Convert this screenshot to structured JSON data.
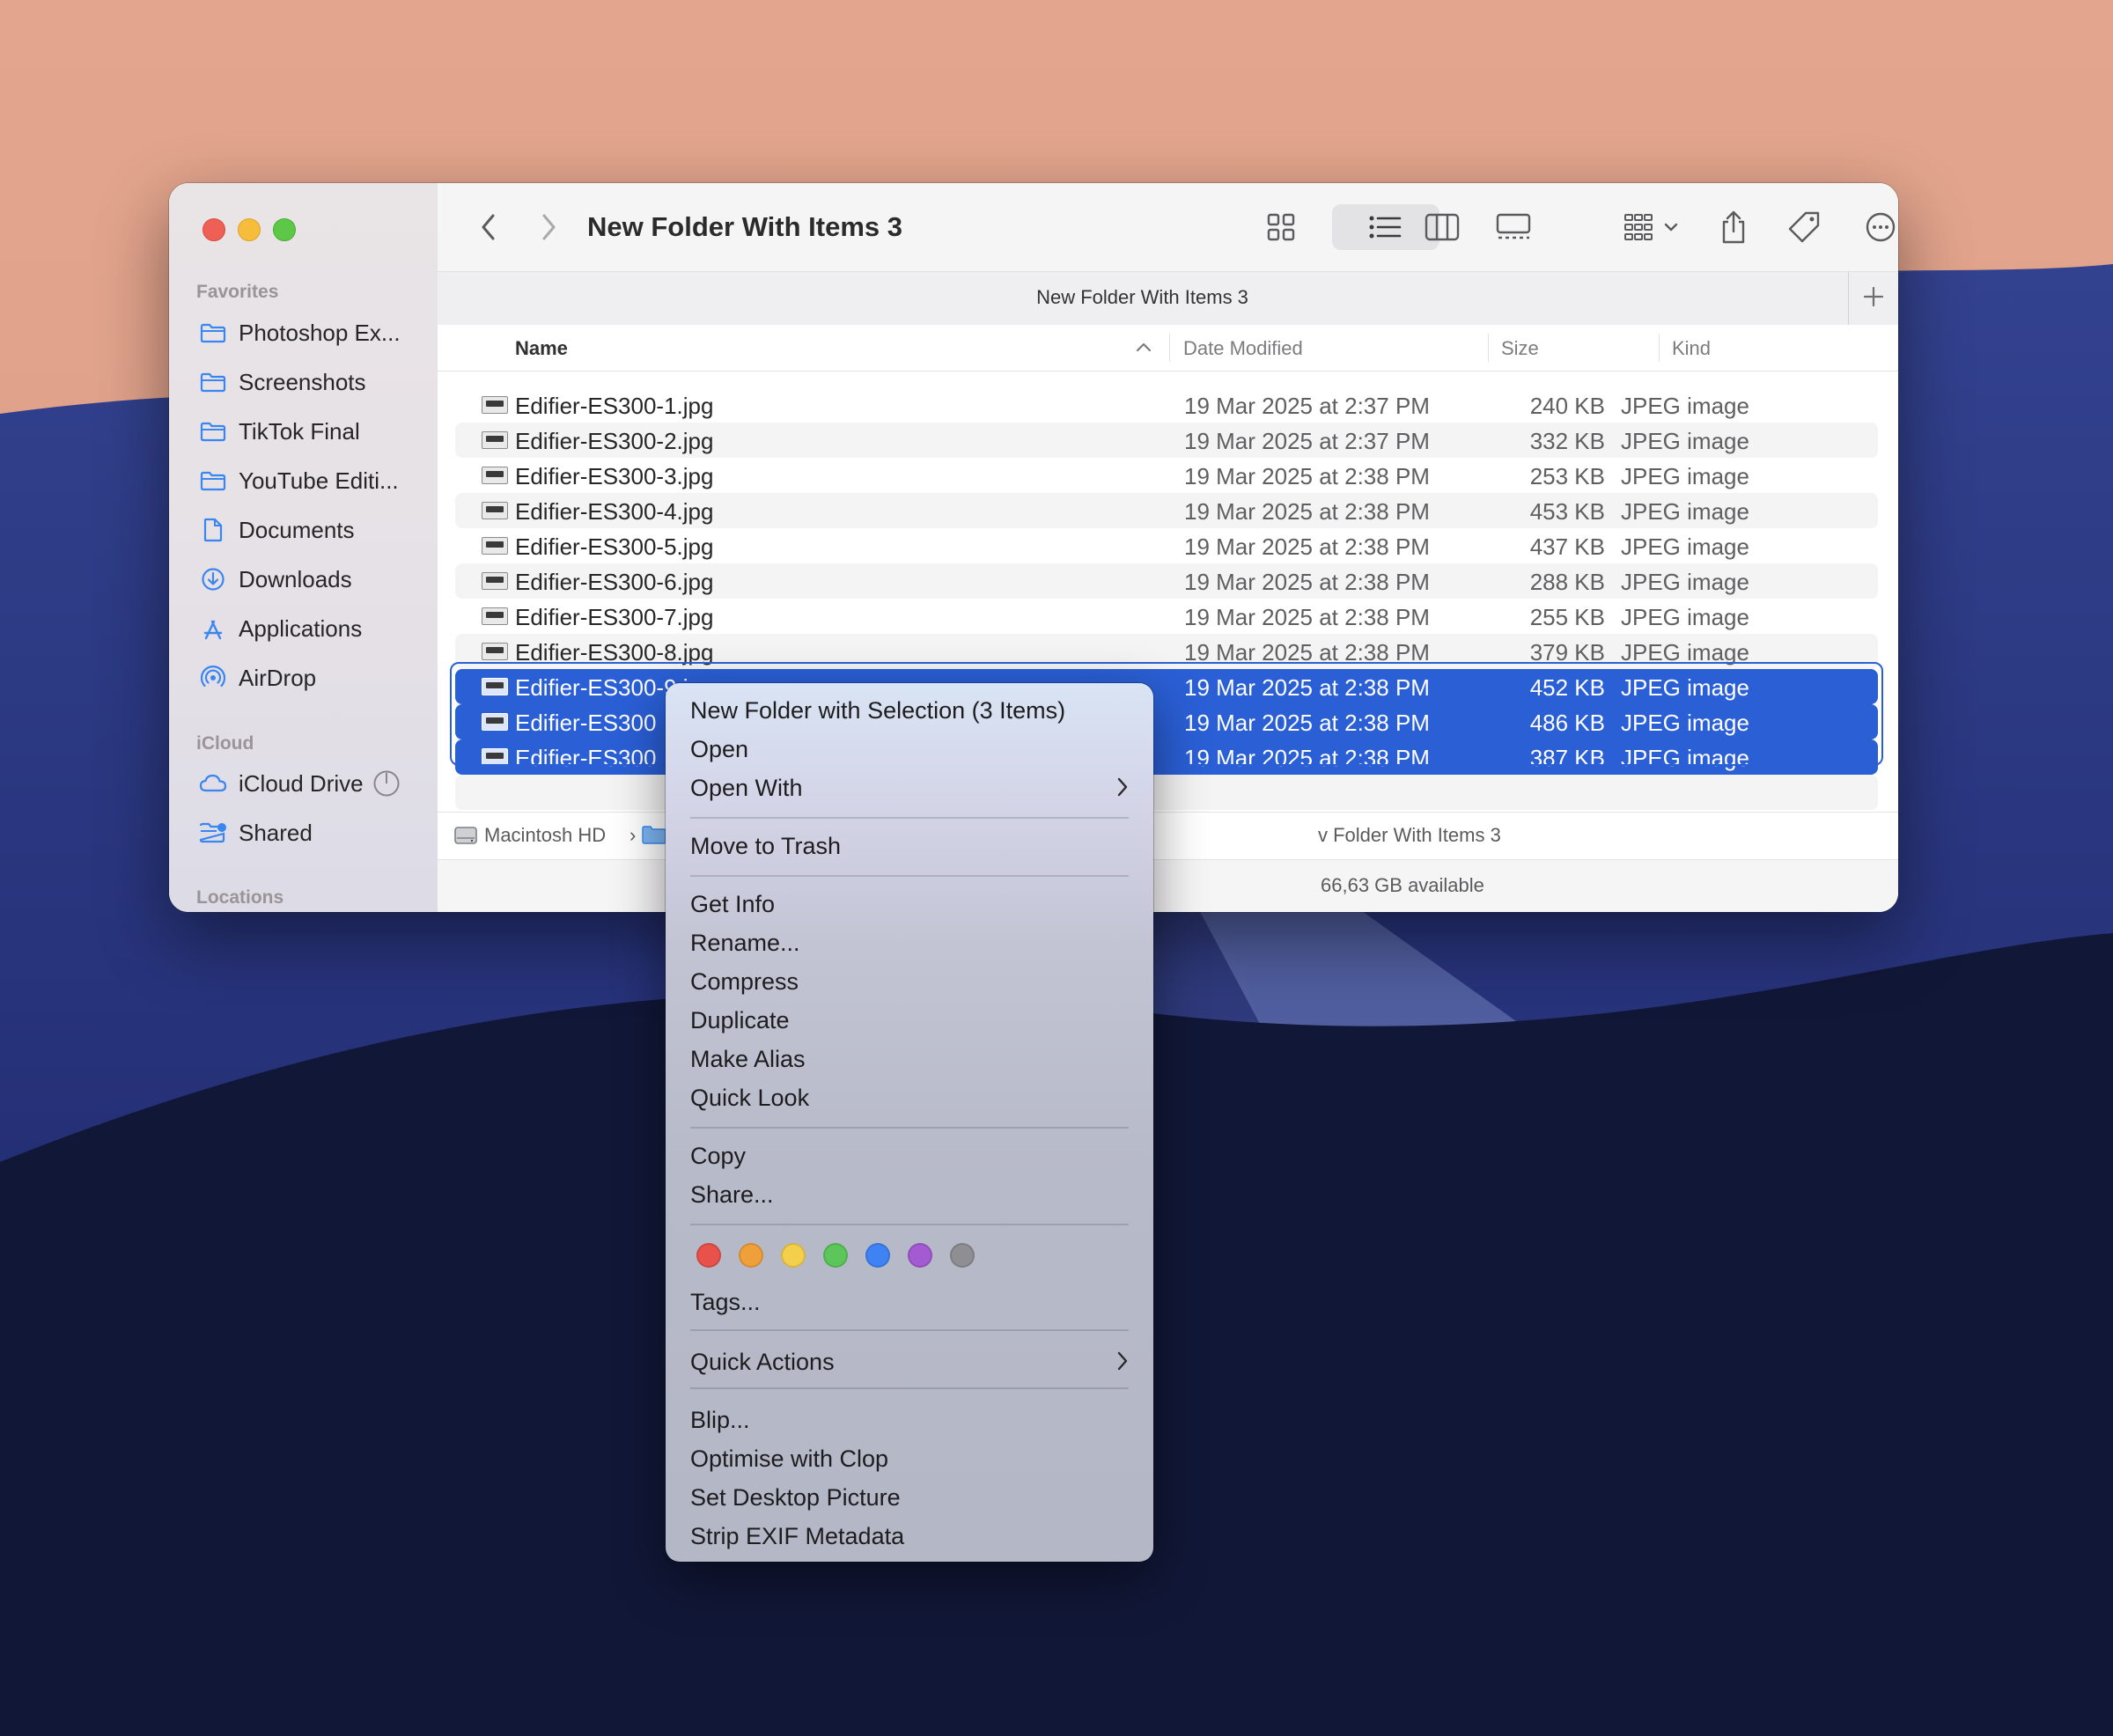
{
  "window": {
    "title": "New Folder With Items 3",
    "tab_title": "New Folder With Items 3"
  },
  "sidebar": {
    "sections": {
      "favorites": "Favorites",
      "icloud": "iCloud",
      "locations": "Locations"
    },
    "favorites": [
      {
        "label": "Photoshop Ex...",
        "icon": "folder-icon"
      },
      {
        "label": "Screenshots",
        "icon": "folder-icon"
      },
      {
        "label": "TikTok Final",
        "icon": "folder-icon"
      },
      {
        "label": "YouTube Editi...",
        "icon": "folder-icon"
      },
      {
        "label": "Documents",
        "icon": "document-icon"
      },
      {
        "label": "Downloads",
        "icon": "download-icon"
      },
      {
        "label": "Applications",
        "icon": "applications-icon"
      },
      {
        "label": "AirDrop",
        "icon": "airdrop-icon"
      }
    ],
    "icloud": [
      {
        "label": "iCloud Drive",
        "icon": "cloud-icon"
      },
      {
        "label": "Shared",
        "icon": "shared-folder-icon"
      }
    ],
    "accent_color": "#3a86f0"
  },
  "columns": {
    "name": "Name",
    "date": "Date Modified",
    "size": "Size",
    "kind": "Kind"
  },
  "files": [
    {
      "name": "Edifier-ES300-1.jpg",
      "date": "19 Mar 2025 at 2:37 PM",
      "size": "240 KB",
      "kind": "JPEG image"
    },
    {
      "name": "Edifier-ES300-2.jpg",
      "date": "19 Mar 2025 at 2:37 PM",
      "size": "332 KB",
      "kind": "JPEG image"
    },
    {
      "name": "Edifier-ES300-3.jpg",
      "date": "19 Mar 2025 at 2:38 PM",
      "size": "253 KB",
      "kind": "JPEG image"
    },
    {
      "name": "Edifier-ES300-4.jpg",
      "date": "19 Mar 2025 at 2:38 PM",
      "size": "453 KB",
      "kind": "JPEG image"
    },
    {
      "name": "Edifier-ES300-5.jpg",
      "date": "19 Mar 2025 at 2:38 PM",
      "size": "437 KB",
      "kind": "JPEG image"
    },
    {
      "name": "Edifier-ES300-6.jpg",
      "date": "19 Mar 2025 at 2:38 PM",
      "size": "288 KB",
      "kind": "JPEG image"
    },
    {
      "name": "Edifier-ES300-7.jpg",
      "date": "19 Mar 2025 at 2:38 PM",
      "size": "255 KB",
      "kind": "JPEG image"
    },
    {
      "name": "Edifier-ES300-8.jpg",
      "date": "19 Mar 2025 at 2:38 PM",
      "size": "379 KB",
      "kind": "JPEG image"
    },
    {
      "name": "Edifier-ES300-9.jpg",
      "date": "19 Mar 2025 at 2:38 PM",
      "size": "452 KB",
      "kind": "JPEG image"
    },
    {
      "name": "Edifier-ES300",
      "date": "19 Mar 2025 at 2:38 PM",
      "size": "486 KB",
      "kind": "JPEG image"
    },
    {
      "name": "Edifier-ES300",
      "date": "19 Mar 2025 at 2:38 PM",
      "size": "387 KB",
      "kind": "JPEG image"
    }
  ],
  "pathbar": {
    "root": "Macintosh HD",
    "current_partial": "v Folder With Items 3"
  },
  "status": {
    "available": "66,63 GB available"
  },
  "context_menu": {
    "new_folder": "New Folder with Selection (3 Items)",
    "open": "Open",
    "open_with": "Open With",
    "move_to_trash": "Move to Trash",
    "get_info": "Get Info",
    "rename": "Rename...",
    "compress": "Compress",
    "duplicate": "Duplicate",
    "make_alias": "Make Alias",
    "quick_look": "Quick Look",
    "copy": "Copy",
    "share": "Share...",
    "tags": "Tags...",
    "quick_actions": "Quick Actions",
    "blip": "Blip...",
    "optimise_clop": "Optimise with Clop",
    "set_desktop": "Set Desktop Picture",
    "strip_exif": "Strip EXIF Metadata",
    "tag_colors": [
      "#e8524a",
      "#f0a03a",
      "#f3cf4b",
      "#5cc65a",
      "#3f82f4",
      "#a45ad2",
      "#8f8f93"
    ]
  },
  "selection_color": "#2a5fd6"
}
